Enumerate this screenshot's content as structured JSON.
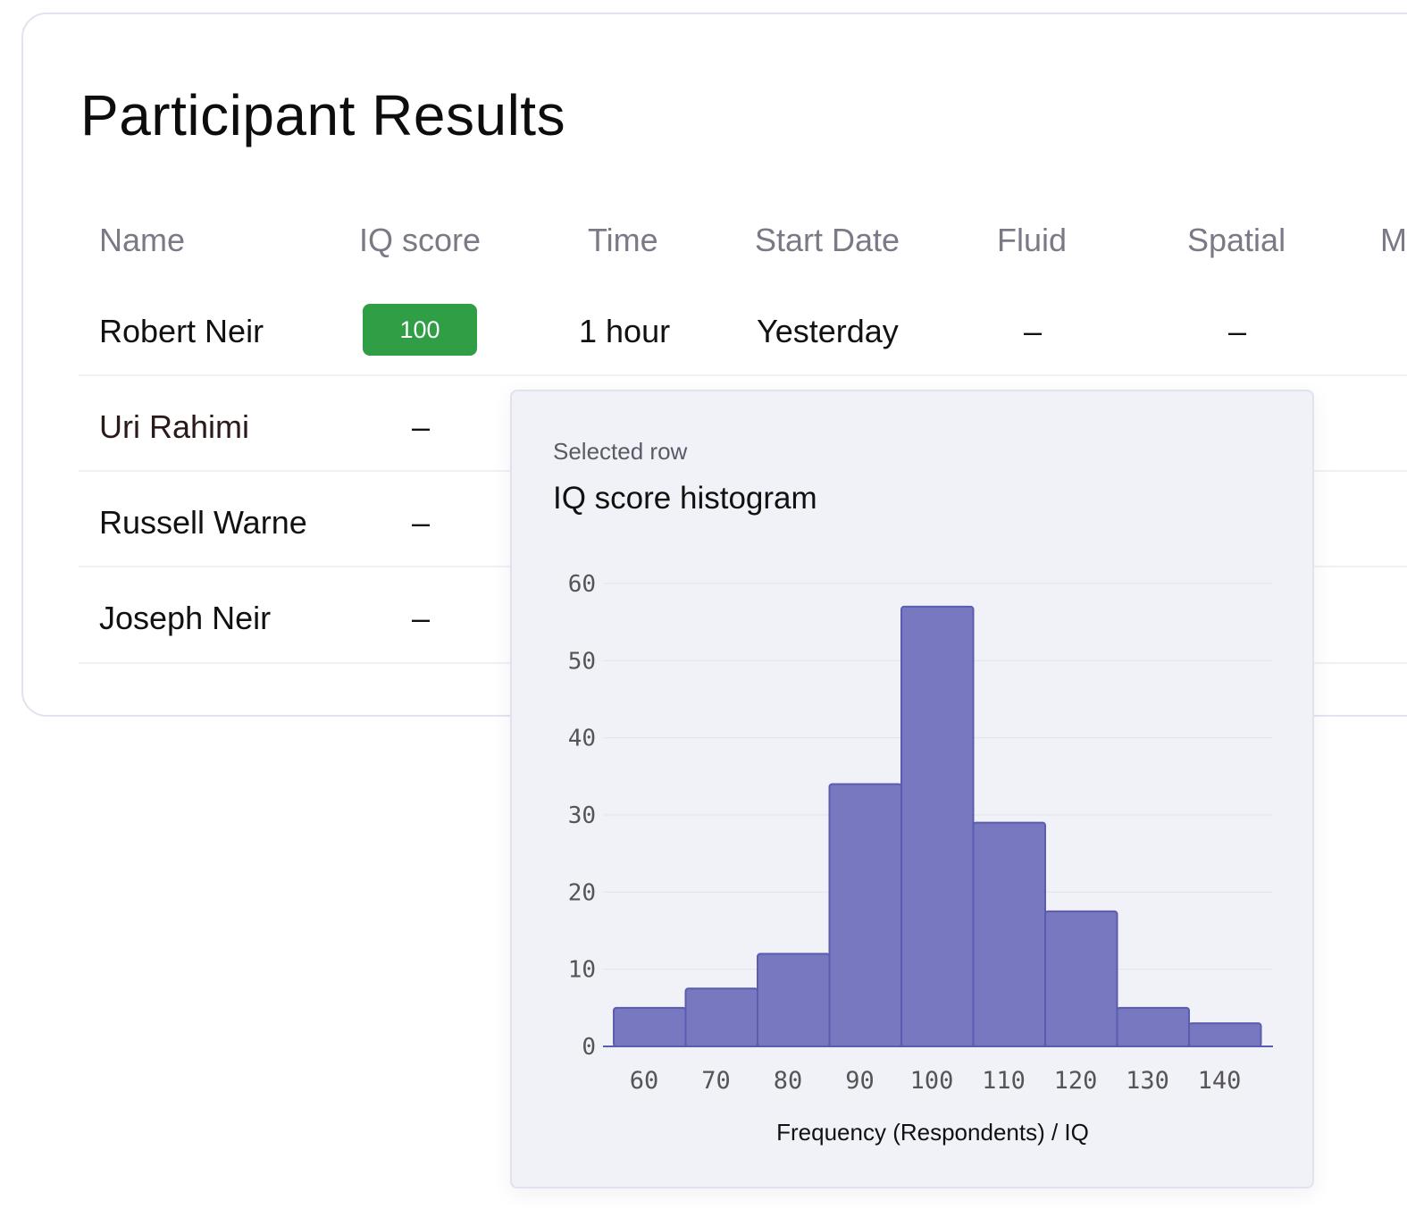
{
  "page": {
    "title": "Participant Results"
  },
  "table": {
    "columns": [
      "Name",
      "IQ score",
      "Time",
      "Start Date",
      "Fluid",
      "Spatial",
      "M"
    ],
    "rows": [
      {
        "name": "Robert Neir",
        "iq": "100",
        "time": "1 hour",
        "start": "Yesterday",
        "fluid": "–",
        "spatial": "–"
      },
      {
        "name": "Uri Rahimi",
        "iq": "–"
      },
      {
        "name": "Russell Warne",
        "iq": "–"
      },
      {
        "name": "Joseph Neir",
        "iq": "–"
      }
    ],
    "badge_color": "#2f9e44"
  },
  "popover": {
    "subtitle": "Selected row",
    "title": "IQ score histogram"
  },
  "chart_data": {
    "type": "bar",
    "xlabel": "Frequency (Respondents) / IQ",
    "ylabel": "",
    "categories": [
      "60",
      "70",
      "80",
      "90",
      "100",
      "110",
      "120",
      "130",
      "140"
    ],
    "values": [
      5,
      7.5,
      12,
      34,
      57,
      29,
      17.5,
      5,
      3
    ],
    "yticks": [
      0,
      10,
      20,
      30,
      40,
      50,
      60
    ],
    "ylim": [
      0,
      60
    ],
    "grid": true,
    "bar_color": "#7878c0",
    "bar_edge_color": "#5b5bb0"
  }
}
